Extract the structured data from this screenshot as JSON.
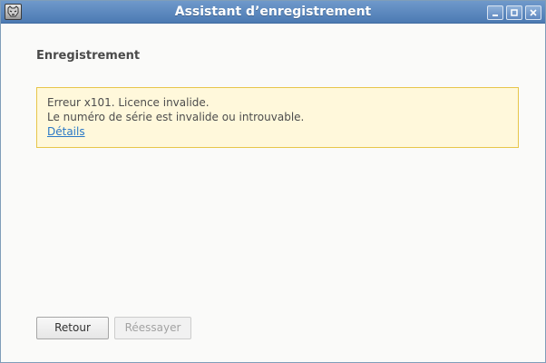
{
  "window": {
    "title": "Assistant d’enregistrement"
  },
  "main": {
    "section_title": "Enregistrement",
    "alert": {
      "line1": "Erreur x101. Licence invalide.",
      "line2": "Le numéro de série est invalide ou introuvable.",
      "link": "Détails"
    }
  },
  "footer": {
    "back_label": "Retour",
    "retry_label": "Réessayer"
  },
  "icons": {
    "app": "tiger-app-icon",
    "minimize": "minimize-icon",
    "maximize": "maximize-icon",
    "close": "close-icon"
  },
  "colors": {
    "titlebar": "#5a86bf",
    "alert_background": "#fff8db",
    "alert_border": "#e7c64a",
    "link": "#2a78c7"
  }
}
